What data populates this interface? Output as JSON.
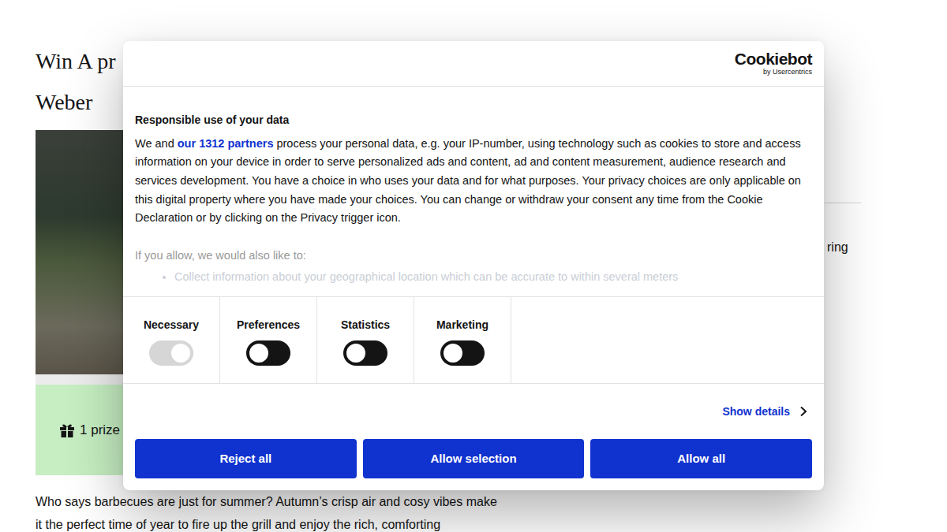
{
  "page": {
    "title_lines": [
      "Win A pr",
      "Weber"
    ],
    "prize_text": "1 prize",
    "side_text": "ring",
    "intro_lines": [
      "Who says barbecues are just for summer? Autumn’s crisp air and cosy vibes make",
      "it the perfect time of year to fire up the grill and enjoy the rich, comforting"
    ]
  },
  "dialog": {
    "logo": {
      "name": "Cookiebot",
      "byline": "by Usercentrics"
    },
    "heading": "Responsible use of your data",
    "intro": {
      "before": "We and ",
      "link": "our 1312 partners",
      "after": " process your personal data, e.g. your IP-number, using technology such as cookies to store and access information on your device in order to serve personalized ads and content, ad and content measurement, audience research and services development. You have a choice in who uses your data and for what purposes. Your privacy choices are only applicable on this digital property where you have made your choices. You can change or withdraw your consent any time from the Cookie Declaration or by clicking on the Privacy trigger icon."
    },
    "more_heading": "If you allow, we would also like to:",
    "more_items": [
      "Collect information about your geographical location which can be accurate to within several meters"
    ],
    "categories": [
      {
        "label": "Necessary",
        "on": true,
        "disabled": true
      },
      {
        "label": "Preferences",
        "on": false,
        "disabled": false
      },
      {
        "label": "Statistics",
        "on": false,
        "disabled": false
      },
      {
        "label": "Marketing",
        "on": false,
        "disabled": false
      }
    ],
    "details_link": "Show details",
    "buttons": [
      "Reject all",
      "Allow selection",
      "Allow all"
    ]
  }
}
